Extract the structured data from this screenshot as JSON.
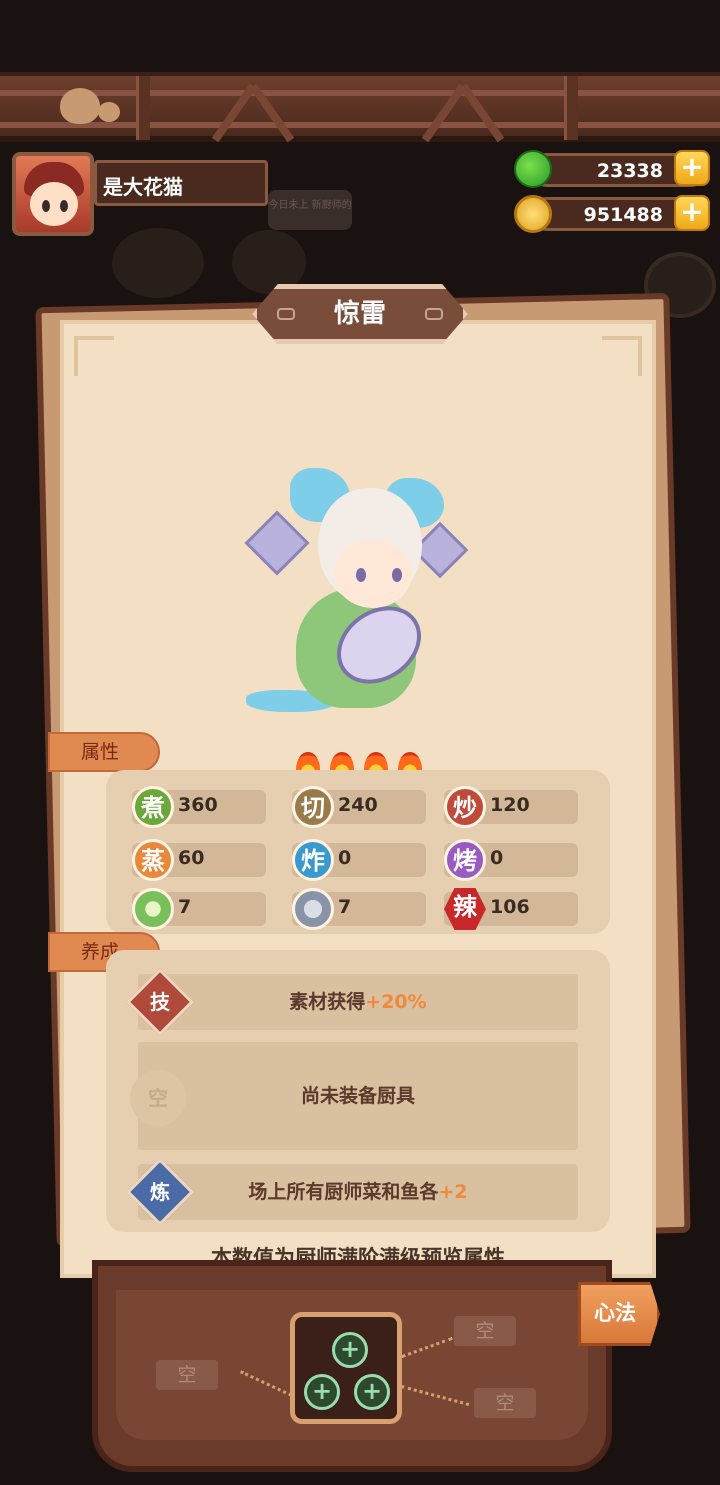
{
  "player": {
    "name": "是大花猫"
  },
  "currency": {
    "jade": "23338",
    "coins": "951488",
    "add_symbol": "+"
  },
  "bubble": {
    "text": "今日未上 新厨师的"
  },
  "chef": {
    "name": "惊雷",
    "stars": 4
  },
  "sections": {
    "attributes": "属性",
    "cultivation": "养成"
  },
  "stats": [
    {
      "icon": "煮",
      "value": "360",
      "color": "#6aa83a"
    },
    {
      "icon": "切",
      "value": "240",
      "color": "#9a7a4a"
    },
    {
      "icon": "炒",
      "value": "120",
      "color": "#c04a3a"
    },
    {
      "icon": "蒸",
      "value": "60",
      "color": "#e8883a"
    },
    {
      "icon": "炸",
      "value": "0",
      "color": "#3a9ad0"
    },
    {
      "icon": "烤",
      "value": "0",
      "color": "#9a5ac0"
    },
    {
      "icon": "cabbage-icon",
      "value": "7",
      "color": "#7ac05a"
    },
    {
      "icon": "fish-icon",
      "value": "7",
      "color": "#8a94a8"
    },
    {
      "icon": "辣",
      "value": "106",
      "color": "#c8282a"
    }
  ],
  "cultivation": {
    "skill": {
      "badge": "技",
      "text": "素材获得",
      "bonus": "+20%"
    },
    "equipment": {
      "badge": "空",
      "text": "尚未装备厨具"
    },
    "refine": {
      "badge": "炼",
      "text": "场上所有厨师菜和鱼各",
      "bonus": "+2"
    }
  },
  "footnote": "本数值为厨师满阶满级预览属性",
  "heart_method": {
    "button": "心法",
    "empty_label": "空",
    "add_symbol": "+"
  }
}
